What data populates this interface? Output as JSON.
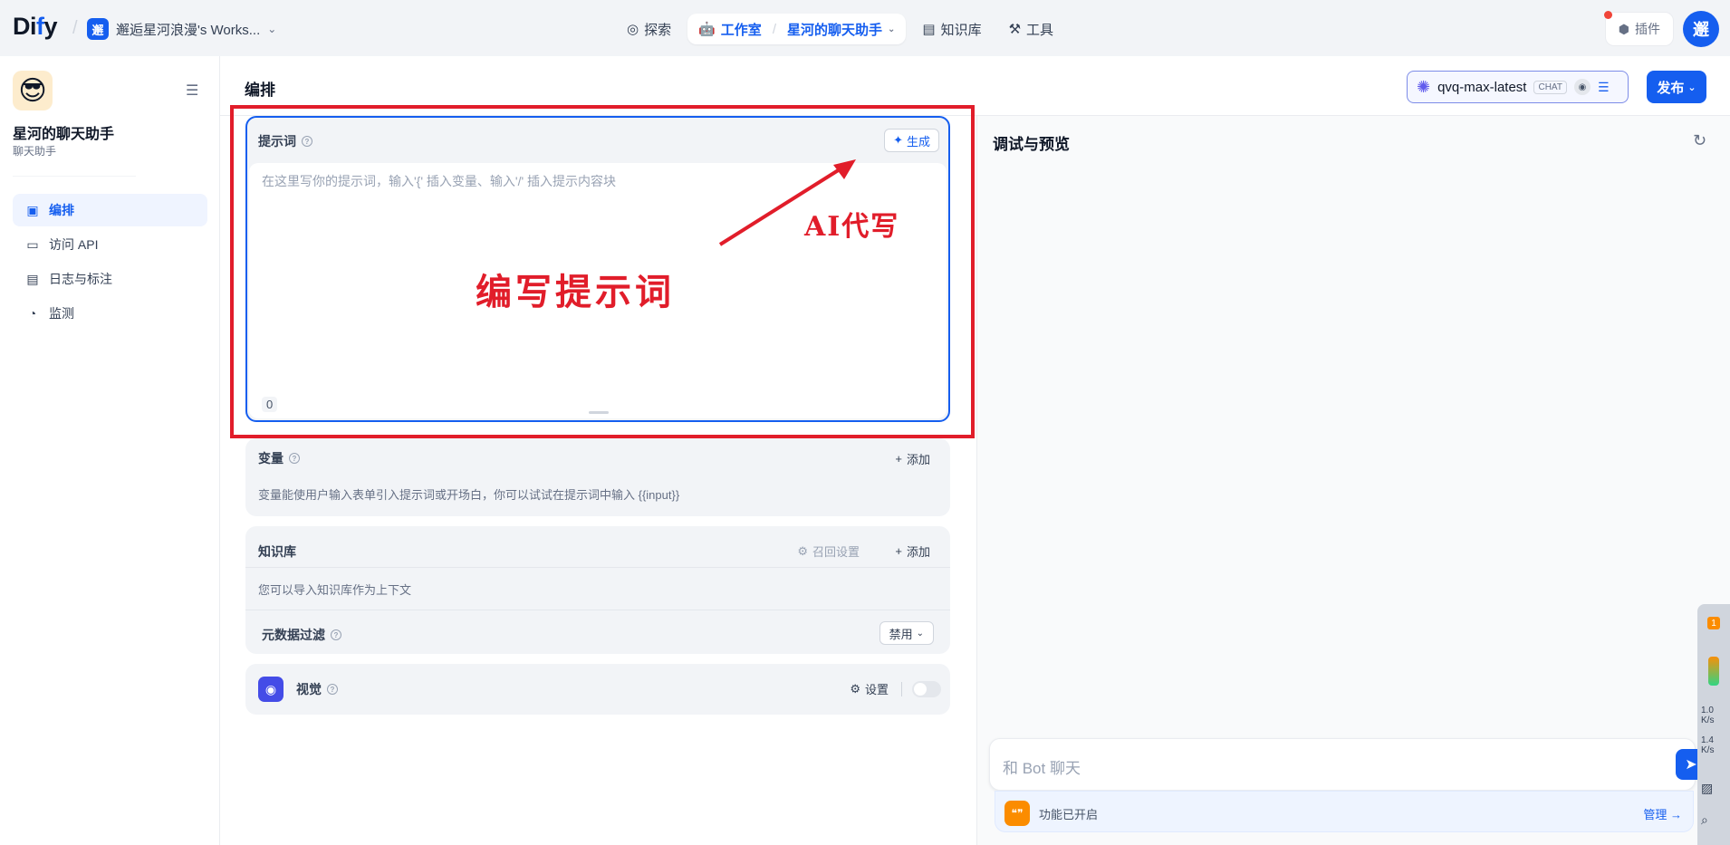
{
  "topbar": {
    "logo_text": "Di",
    "logo_accent": "f",
    "logo_tail": "y",
    "workspace_avatar": "邂",
    "workspace_name": "邂逅星河浪漫's Works...",
    "nav": {
      "explore": "探索",
      "studio": "工作室",
      "studio_app": "星河的聊天助手",
      "knowledge": "知识库",
      "tools": "工具"
    },
    "plugin_label": "插件",
    "user_avatar": "邂"
  },
  "sidebar": {
    "app_title": "星河的聊天助手",
    "app_subtitle": "聊天助手",
    "items": [
      {
        "label": "编排",
        "icon": "layout-icon",
        "active": true
      },
      {
        "label": "访问 API",
        "icon": "terminal-icon",
        "active": false
      },
      {
        "label": "日志与标注",
        "icon": "document-icon",
        "active": false
      },
      {
        "label": "监测",
        "icon": "gauge-icon",
        "active": false
      }
    ]
  },
  "header": {
    "title": "编排",
    "model_name": "qvq-max-latest",
    "model_tag": "CHAT",
    "publish_label": "发布"
  },
  "prompt": {
    "label": "提示词",
    "generate_label": "生成",
    "placeholder": "在这里写你的提示词，输入'{' 插入变量、输入'/' 插入提示内容块",
    "char_count": "0"
  },
  "annotations": {
    "main_text": "编写提示词",
    "arrow_text": "AI代写",
    "color": "#e11d2a"
  },
  "variables": {
    "title": "变量",
    "add_label": "添加",
    "description": "变量能使用户输入表单引入提示词或开场白，你可以试试在提示词中输入 {{input}}"
  },
  "knowledge": {
    "title": "知识库",
    "recall_label": "召回设置",
    "add_label": "添加",
    "description": "您可以导入知识库作为上下文",
    "metadata_filter_label": "元数据过滤",
    "metadata_filter_value": "禁用"
  },
  "vision": {
    "title": "视觉",
    "settings_label": "设置",
    "enabled": false
  },
  "debug": {
    "title": "调试与预览",
    "chat_placeholder": "和 Bot 聊天",
    "features_text": "功能已开启",
    "manage_label": "管理 →"
  },
  "widget": {
    "badge": "1",
    "up_value": "1.0",
    "up_unit": "K/s",
    "down_value": "1.4",
    "down_unit": "K/s"
  },
  "colors": {
    "accent": "#155eef",
    "annotation": "#e11d2a"
  }
}
